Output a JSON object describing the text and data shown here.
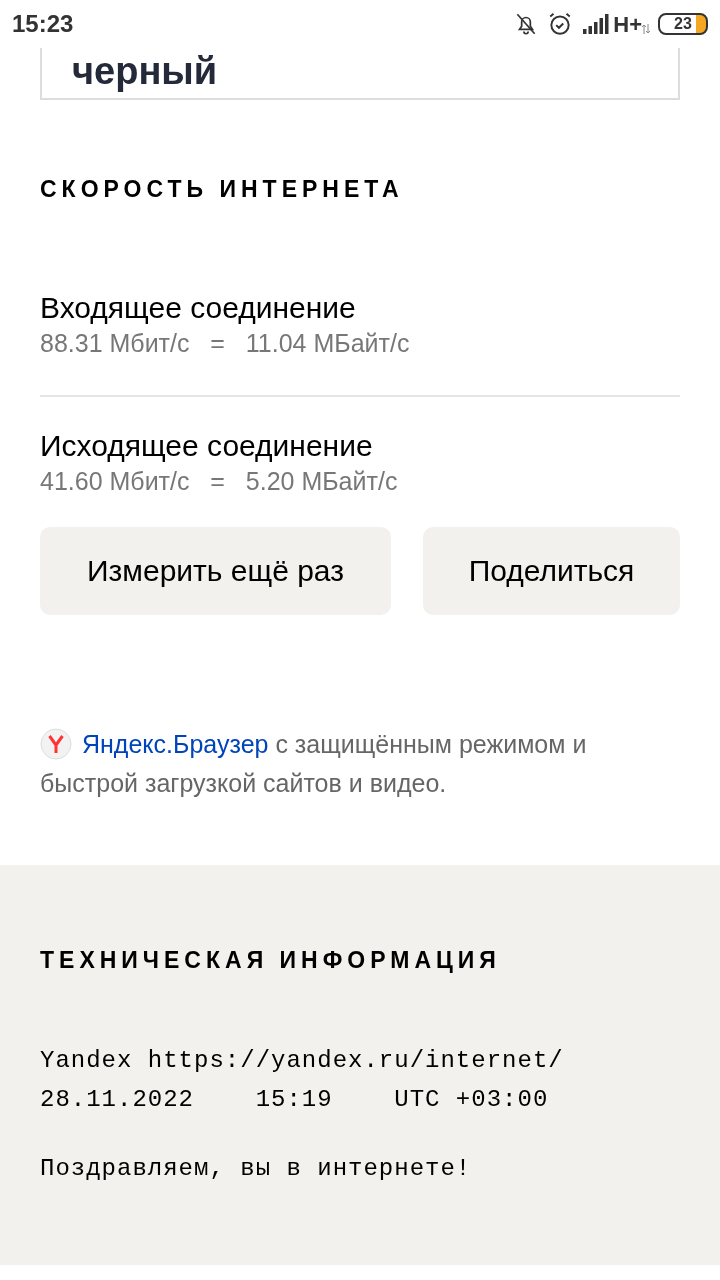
{
  "status_bar": {
    "time": "15:23",
    "network": "H+",
    "battery": "23"
  },
  "top_card": {
    "text": "черный"
  },
  "speed": {
    "heading": "СКОРОСТЬ ИНТЕРНЕТА",
    "rows": [
      {
        "title": "Входящее соединение",
        "value": "88.31 Мбит/с   =   11.04 МБайт/с"
      },
      {
        "title": "Исходящее соединение",
        "value": "41.60 Мбит/с   =   5.20 МБайт/с"
      }
    ],
    "buttons": [
      "Измерить ещё раз",
      "Поделиться"
    ]
  },
  "promo": {
    "link": "Яндекс.Браузер",
    "text": "с защищённым режимом и быстрой загрузкой сайтов и видео."
  },
  "tech": {
    "heading": "ТЕХНИЧЕСКАЯ ИНФОРМАЦИЯ",
    "lines": [
      "Yandex https://yandex.ru/internet/",
      "28.11.2022    15:19    UTC +03:00"
    ],
    "message": "Поздравляем, вы в интернете!"
  }
}
